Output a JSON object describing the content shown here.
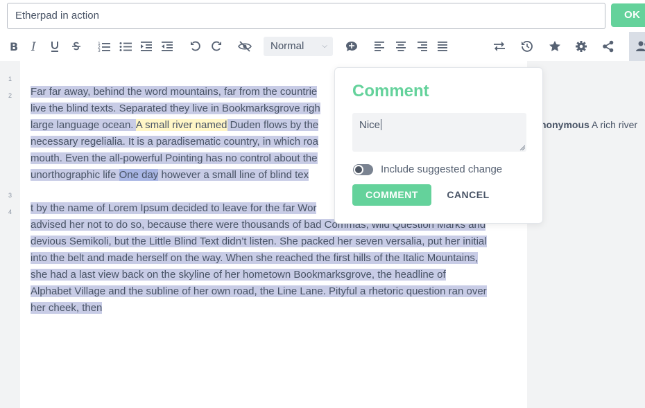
{
  "pad": {
    "title": "Etherpad in action",
    "ok_label": "OK"
  },
  "toolbar": {
    "items": [
      {
        "name": "bold-button",
        "icon": "bold-icon",
        "glyph": "B"
      },
      {
        "name": "italic-button",
        "icon": "italic-icon",
        "glyph": "I"
      },
      {
        "name": "underline-button",
        "icon": "underline-icon",
        "glyph": "U"
      },
      {
        "name": "strikethrough-button",
        "icon": "strikethrough-icon",
        "glyph": "S"
      },
      {
        "name": "ordered-list-button",
        "icon": "ordered-list-icon"
      },
      {
        "name": "unordered-list-button",
        "icon": "unordered-list-icon"
      },
      {
        "name": "indent-button",
        "icon": "indent-icon"
      },
      {
        "name": "outdent-button",
        "icon": "outdent-icon"
      },
      {
        "name": "undo-button",
        "icon": "undo-icon"
      },
      {
        "name": "redo-button",
        "icon": "redo-icon"
      },
      {
        "name": "clear-authorship-button",
        "icon": "eye-slash-icon"
      },
      {
        "name": "add-comment-button",
        "icon": "comment-icon"
      },
      {
        "name": "align-left-button",
        "icon": "align-left-icon"
      },
      {
        "name": "align-center-button",
        "icon": "align-center-icon"
      },
      {
        "name": "align-right-button",
        "icon": "align-right-icon"
      },
      {
        "name": "align-justify-button",
        "icon": "align-justify-icon"
      },
      {
        "name": "import-export-button",
        "icon": "exchange-icon"
      },
      {
        "name": "timeslider-button",
        "icon": "history-icon"
      },
      {
        "name": "star-button",
        "icon": "star-icon"
      },
      {
        "name": "settings-button",
        "icon": "gear-icon"
      },
      {
        "name": "share-button",
        "icon": "share-icon"
      },
      {
        "name": "users-button",
        "icon": "users-icon"
      }
    ],
    "heading_select": "Normal"
  },
  "editor": {
    "line_numbers": [
      "1",
      "2",
      "3",
      "4"
    ],
    "para1": {
      "l1": "Far far away, behind the word mountains, far from the countrie",
      "l2": "live the blind texts. Separated they live in Bookmarksgrove righ",
      "l3a": "large language ocean. ",
      "l3b": "A small river named",
      "l3c": " Duden flows by the",
      "l4": "necessary regelialia. It is a paradisematic country, in which roa",
      "l5": "mouth. Even the all-powerful Pointing has no control about the",
      "l6a": "unorthographic life ",
      "l6b": "One day",
      "l6c": " however a small line of blind tex"
    },
    "para2": {
      "l1": "t by the name of Lorem Ipsum decided to leave for the far Wor",
      "l2": "advised her not to do so, because there were thousands of bad Commas, wild Question Marks and",
      "l3": "devious Semikoli, but the Little Blind Text didn’t listen. She packed her seven versalia, put her initial",
      "l4": "into the belt and made herself on the way. When she reached the first hills of the Italic Mountains,",
      "l5": "she had a last view back on the skyline of her hometown Bookmarksgrove, the headline of",
      "l6": "Alphabet Village and the subline of her own road, the Line Lane. Pityful a rhetoric question ran over",
      "l7": "her cheek, then"
    }
  },
  "side_comment": {
    "author": "nonymous",
    "text": "A rich river"
  },
  "comment_popup": {
    "title": "Comment",
    "input_value": "Nice",
    "toggle_label": "Include suggested change",
    "toggle_on": false,
    "submit_label": "COMMENT",
    "cancel_label": "CANCEL"
  },
  "colors": {
    "accent": "#64d29b",
    "selection": "#c8cce6",
    "author_highlight": "#fff6c6",
    "text": "#485365"
  }
}
